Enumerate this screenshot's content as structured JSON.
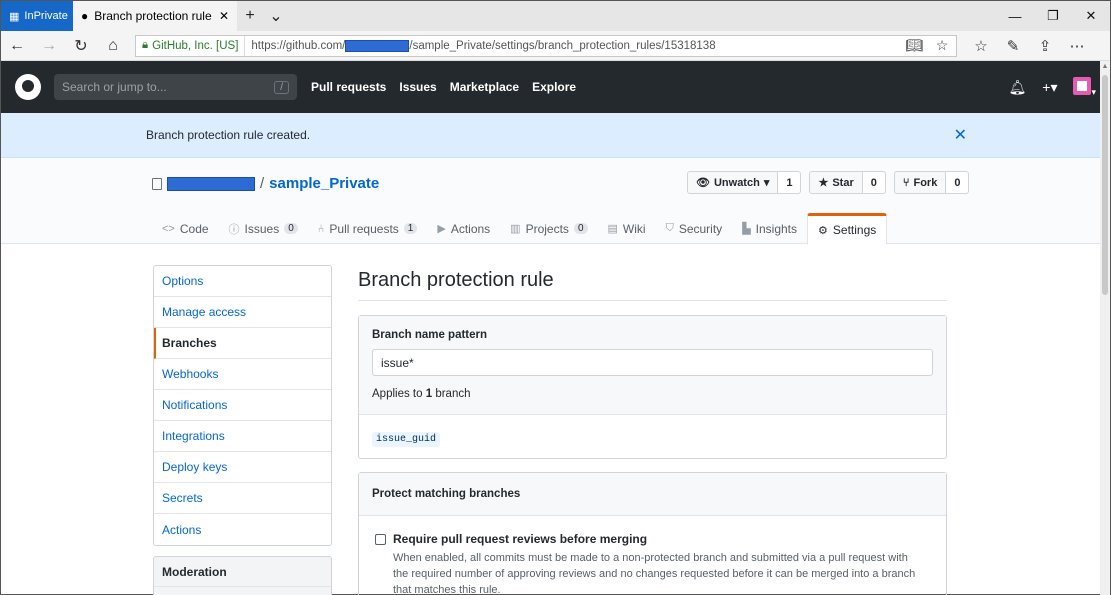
{
  "browser": {
    "inprivate_label": "InPrivate",
    "tab_title": "Branch protection rule",
    "cert_label": "GitHub, Inc. [US]",
    "url_prefix": "https://github.com/",
    "url_suffix": "/sample_Private/settings/branch_protection_rules/15318138"
  },
  "header": {
    "search_placeholder": "Search or jump to...",
    "search_key": "/",
    "nav": [
      "Pull requests",
      "Issues",
      "Marketplace",
      "Explore"
    ]
  },
  "flash": {
    "message": "Branch protection rule created."
  },
  "repo": {
    "separator": "/",
    "name": "sample_Private",
    "watch_label": "Unwatch",
    "watch_count": "1",
    "star_label": "Star",
    "star_count": "0",
    "fork_label": "Fork",
    "fork_count": "0",
    "tabs": [
      {
        "label": "Code",
        "counter": ""
      },
      {
        "label": "Issues",
        "counter": "0"
      },
      {
        "label": "Pull requests",
        "counter": "1"
      },
      {
        "label": "Actions",
        "counter": ""
      },
      {
        "label": "Projects",
        "counter": "0"
      },
      {
        "label": "Wiki",
        "counter": ""
      },
      {
        "label": "Security",
        "counter": ""
      },
      {
        "label": "Insights",
        "counter": ""
      },
      {
        "label": "Settings",
        "counter": ""
      }
    ]
  },
  "sidebar": {
    "items": [
      "Options",
      "Manage access",
      "Branches",
      "Webhooks",
      "Notifications",
      "Integrations",
      "Deploy keys",
      "Secrets",
      "Actions"
    ],
    "active_index": 2,
    "moderation_heading": "Moderation"
  },
  "main": {
    "title": "Branch protection rule",
    "pattern_label": "Branch name pattern",
    "pattern_value": "issue*",
    "applies_prefix": "Applies to",
    "applies_count": "1",
    "applies_suffix": "branch",
    "matched_branch": "issue_guid",
    "protect_heading": "Protect matching branches",
    "rule_title": "Require pull request reviews before merging",
    "rule_desc": "When enabled, all commits must be made to a non-protected branch and submitted via a pull request with the required number of approving reviews and no changes requested before it can be merged into a branch that matches this rule."
  },
  "colors": {
    "accent": "#0366d6",
    "header_bg": "#24292e",
    "flash_bg": "#dbedff",
    "selected_tab_border": "#e36209",
    "redaction": "#2f6bd4"
  }
}
